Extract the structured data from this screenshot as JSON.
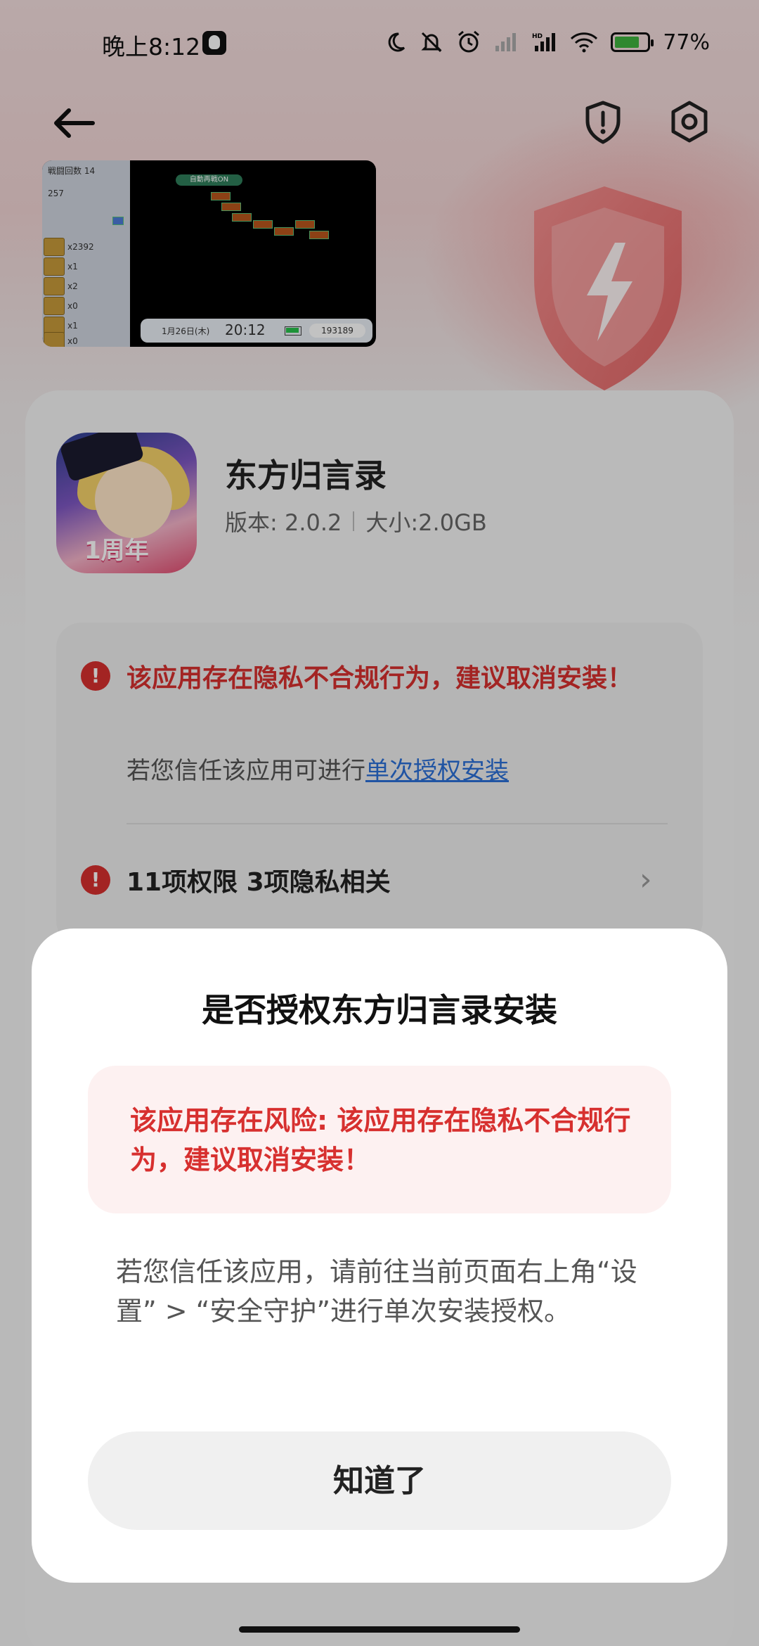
{
  "status_bar": {
    "time": "晚上8:12",
    "battery_pct": "77%",
    "icons": [
      "qq-icon",
      "moon-icon",
      "bell-off-icon",
      "alarm-icon",
      "signal-off-icon",
      "hd-signal-icon",
      "wifi-icon",
      "battery-icon"
    ]
  },
  "top_bar": {
    "icons": [
      "back-arrow-icon",
      "shield-alert-icon",
      "settings-icon"
    ]
  },
  "screenshot": {
    "battles": "戦闘回数 14",
    "money": "257",
    "items": [
      "x2392",
      "x1",
      "x2",
      "x0",
      "x1",
      "x0"
    ],
    "auto_label": "自動再戦ON",
    "date": "1月26日(木)",
    "time": "20:12",
    "points": "193189"
  },
  "app": {
    "name": "东方归言录",
    "version": "版本: 2.0.2",
    "size": "大小:2.0GB",
    "icon_badge": "1周年"
  },
  "warning": {
    "title": "该应用存在隐私不合规行为，建议取消安装！",
    "sub_prefix": "若您信任该应用可进行",
    "sub_link": "单次授权安装",
    "permissions": "11项权限 3项隐私相关",
    "icon": "!"
  },
  "dialog": {
    "title": "是否授权东方归言录安装",
    "risk": "该应用存在风险: 该应用存在隐私不合规行为，建议取消安装！",
    "body": "若您信任该应用，请前往当前页面右上角“设置” > “安全守护”进行单次安装授权。",
    "button": "知道了"
  },
  "colors": {
    "danger": "#d7302f",
    "link": "#2b6fd6",
    "battery": "#3fb33f"
  }
}
